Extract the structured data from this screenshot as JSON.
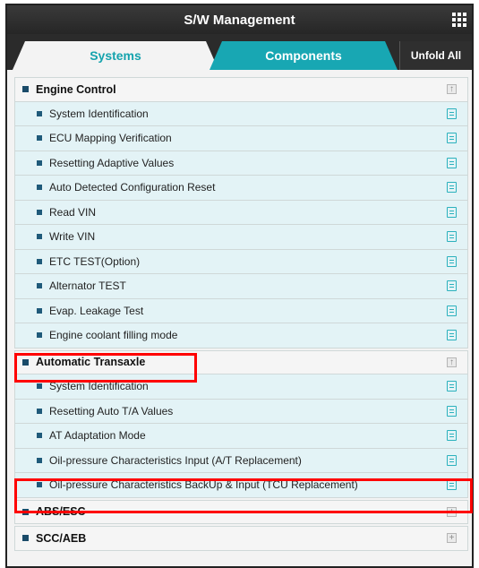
{
  "header": {
    "title": "S/W Management",
    "menu_icon": "grid-icon"
  },
  "tabs": {
    "systems": "Systems",
    "components": "Components",
    "unfold_all": "Unfold All"
  },
  "sections": [
    {
      "title": "Engine Control",
      "expand_icon": "collapse-icon",
      "items": [
        "System Identification",
        "ECU Mapping Verification",
        "Resetting Adaptive Values",
        "Auto Detected Configuration Reset",
        "Read VIN",
        "Write VIN",
        "ETC TEST(Option)",
        "Alternator TEST",
        "Evap. Leakage Test",
        "Engine coolant filling mode"
      ]
    },
    {
      "title": "Automatic Transaxle",
      "expand_icon": "collapse-icon",
      "items": [
        "System Identification",
        "Resetting Auto T/A Values",
        "AT Adaptation Mode",
        "Oil-pressure Characteristics Input (A/T Replacement)",
        "Oil-pressure Characteristics BackUp & Input (TCU Replacement)"
      ]
    },
    {
      "title": "ABS/ESC",
      "expand_icon": "expand-icon",
      "items": []
    },
    {
      "title": "SCC/AEB",
      "expand_icon": "expand-icon",
      "items": []
    }
  ],
  "colors": {
    "accent": "#18a7b3",
    "header_bg": "#2b2b2b",
    "item_bg": "#e3f3f6",
    "highlight": "#ff0000"
  }
}
